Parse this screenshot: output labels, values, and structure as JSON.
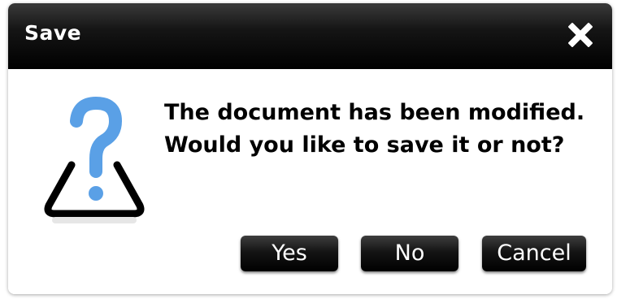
{
  "dialog": {
    "title": "Save",
    "close_icon": "close-icon",
    "message_line1": "The document has been modified.",
    "message_line2": "Would you like to save it or not?",
    "icon": "question-warning-icon"
  },
  "buttons": {
    "yes_label": "Yes",
    "no_label": "No",
    "cancel_label": "Cancel"
  },
  "colors": {
    "titlebar": "#000000",
    "button": "#111111",
    "icon_accent": "#5aa0e6",
    "icon_outline": "#000000"
  }
}
